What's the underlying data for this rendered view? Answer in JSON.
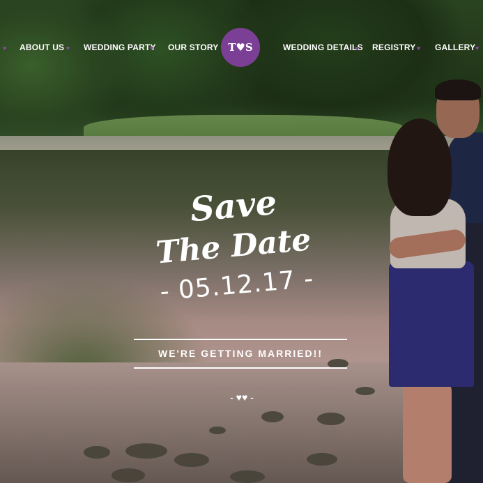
{
  "nav": {
    "items_left": [
      "ABOUT US",
      "WEDDING PARTY",
      "OUR STORY"
    ],
    "items_right": [
      "WEDDING DETAILS",
      "REGISTRY",
      "GALLERY"
    ],
    "monogram": "T♥S",
    "separator_icon": "heart-icon",
    "accent_color": "#7b3f95"
  },
  "hero": {
    "line1": "Save",
    "line2": "The Date",
    "date": "- 05.12.17 -",
    "tagline": "WE'RE GETTING MARRIED!!",
    "divider": "- ♥♥ -"
  }
}
